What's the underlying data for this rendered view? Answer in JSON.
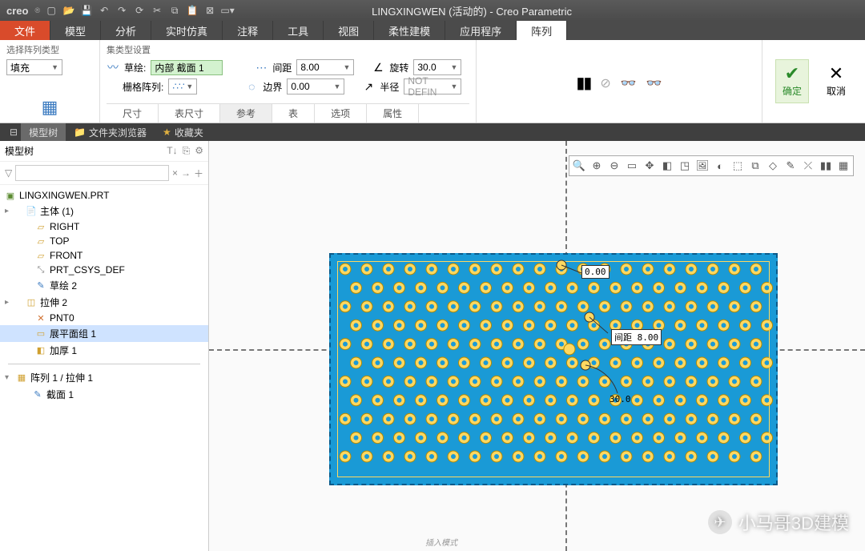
{
  "app": {
    "name": "creo",
    "window_title": "LINGXINGWEN (活动的) - Creo Parametric"
  },
  "qat_icons": [
    "new-file",
    "open-file",
    "save",
    "undo",
    "redo",
    "regen",
    "cut",
    "copy",
    "paste",
    "window",
    "settings"
  ],
  "tabs": {
    "file": "文件",
    "items": [
      "模型",
      "分析",
      "实时仿真",
      "注释",
      "工具",
      "视图",
      "柔性建模",
      "应用程序"
    ],
    "active": "阵列"
  },
  "ribbon": {
    "type_panel": {
      "label": "选择阵列类型",
      "value": "填充"
    },
    "set_panel": {
      "label": "集类型设置",
      "sketch_label": "草绘:",
      "sketch_value": "内部 截面 1",
      "grid_label": "栅格阵列:",
      "spacing_label": "间距",
      "spacing_value": "8.00",
      "border_label": "边界",
      "border_value": "0.00",
      "rotate_label": "旋转",
      "rotate_value": "30.0",
      "radius_label": "半径",
      "radius_value": "NOT DEFIN"
    },
    "subtabs": [
      "尺寸",
      "表尺寸",
      "参考",
      "表",
      "选项",
      "属性"
    ],
    "subtab_active": "参考",
    "pause_icons": [
      "pause",
      "no",
      "glasses1",
      "glasses2"
    ],
    "ok": "确定",
    "cancel": "取消"
  },
  "sidebar_tabs": {
    "tree": "模型树",
    "browser": "文件夹浏览器",
    "fav": "收藏夹"
  },
  "sidebar": {
    "title": "模型树",
    "root": "LINGXINGWEN.PRT",
    "nodes": [
      {
        "exp": "▸",
        "icon": "📄",
        "label": "主体 (1)",
        "ind": 8
      },
      {
        "exp": "",
        "icon": "▱",
        "label": "RIGHT",
        "ind": 20,
        "c": "#d0a030"
      },
      {
        "exp": "",
        "icon": "▱",
        "label": "TOP",
        "ind": 20,
        "c": "#d0a030"
      },
      {
        "exp": "",
        "icon": "▱",
        "label": "FRONT",
        "ind": 20,
        "c": "#d0a030"
      },
      {
        "exp": "",
        "icon": "⤡",
        "label": "PRT_CSYS_DEF",
        "ind": 20,
        "c": "#888"
      },
      {
        "exp": "",
        "icon": "✎",
        "label": "草绘 2",
        "ind": 20,
        "c": "#3a7ac0"
      },
      {
        "exp": "▸",
        "icon": "◫",
        "label": "拉伸 2",
        "ind": 8,
        "c": "#d0a030"
      },
      {
        "exp": "",
        "icon": "✕",
        "label": "PNT0",
        "ind": 20,
        "c": "#d07030"
      },
      {
        "exp": "",
        "icon": "▭",
        "label": "展平面组 1",
        "ind": 20,
        "c": "#d0a030",
        "sel": true
      },
      {
        "exp": "",
        "icon": "◧",
        "label": "加厚 1",
        "ind": 20,
        "c": "#d0a030"
      }
    ],
    "pattern": {
      "exp": "▾",
      "icon": "▦",
      "label": "阵列 1 / 拉伸 1",
      "child_icon": "✎",
      "child": "截面 1"
    }
  },
  "canvas": {
    "dim_top": "0.00",
    "dim_mid": "间距 8.00",
    "dim_bot": "30.0",
    "toolbar_icons": [
      "zoom-fit",
      "zoom-in",
      "zoom-out",
      "box",
      "pan",
      "layers",
      "view",
      "save-img",
      "shade",
      "wireframe",
      "edges",
      "perspective",
      "annot",
      "axes",
      "pause",
      "grid"
    ]
  },
  "watermark": "小马哥3D建模",
  "footer": "插入模式"
}
